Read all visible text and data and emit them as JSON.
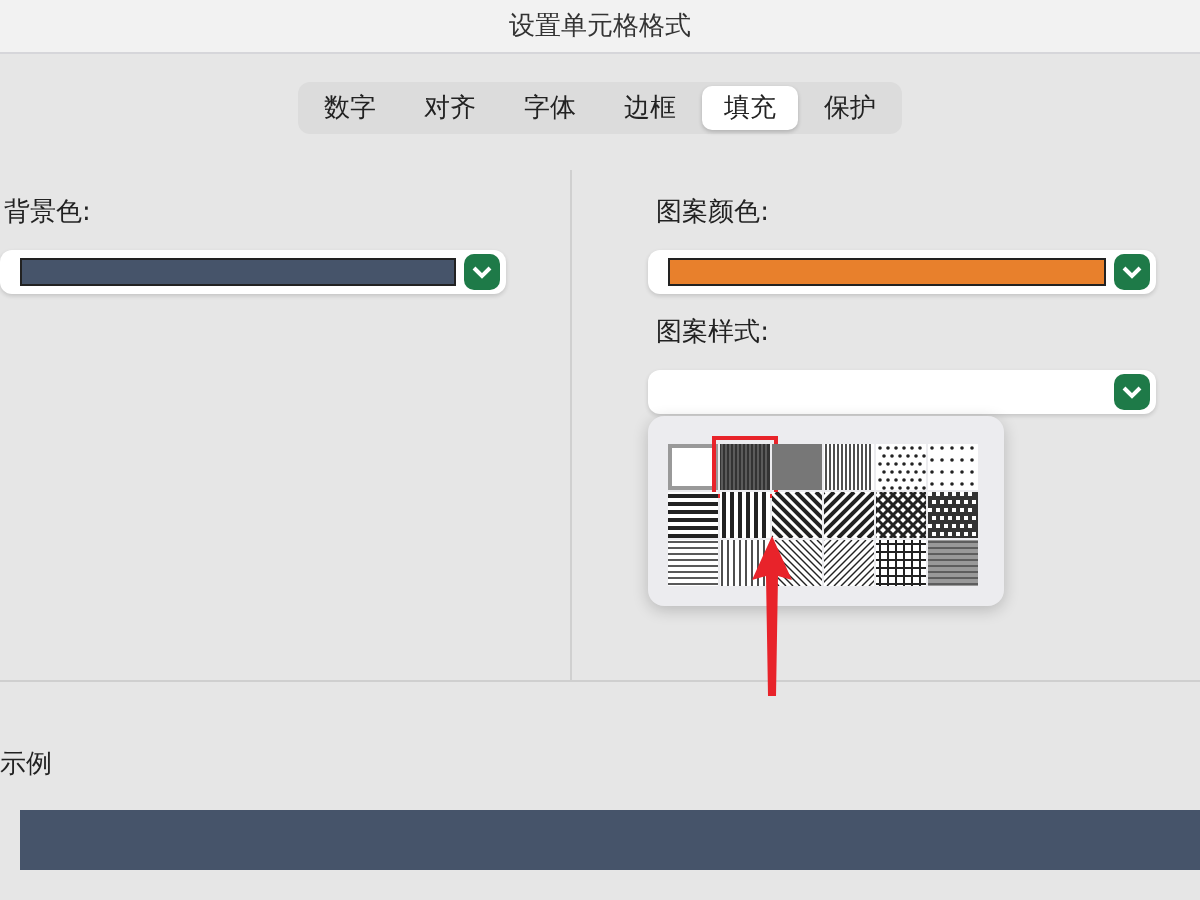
{
  "window": {
    "title": "设置单元格格式"
  },
  "tabs": [
    {
      "label": "数字",
      "selected": false
    },
    {
      "label": "对齐",
      "selected": false
    },
    {
      "label": "字体",
      "selected": false
    },
    {
      "label": "边框",
      "selected": false
    },
    {
      "label": "填充",
      "selected": true
    },
    {
      "label": "保护",
      "selected": false
    }
  ],
  "background": {
    "label": "背景色:",
    "color": "#46546a"
  },
  "pattern_color": {
    "label": "图案颜色:",
    "color": "#e8802c"
  },
  "pattern_style": {
    "label": "图案样式:"
  },
  "patterns": [
    {
      "kind": "solid",
      "selected": true,
      "highlighted": false
    },
    {
      "kind": "dark",
      "selected": false,
      "highlighted": true
    },
    {
      "kind": "medium",
      "selected": false,
      "highlighted": false
    },
    {
      "kind": "light",
      "selected": false,
      "highlighted": false
    },
    {
      "kind": "dots",
      "selected": false,
      "highlighted": false
    },
    {
      "kind": "sparse",
      "selected": false,
      "highlighted": false
    },
    {
      "kind": "hlines",
      "selected": false,
      "highlighted": false
    },
    {
      "kind": "vlines",
      "selected": false,
      "highlighted": false
    },
    {
      "kind": "diagdown",
      "selected": false,
      "highlighted": false
    },
    {
      "kind": "diagup",
      "selected": false,
      "highlighted": false
    },
    {
      "kind": "crosshatch",
      "selected": false,
      "highlighted": false
    },
    {
      "kind": "checker",
      "selected": false,
      "highlighted": false
    },
    {
      "kind": "thinh",
      "selected": false,
      "highlighted": false
    },
    {
      "kind": "thinv",
      "selected": false,
      "highlighted": false
    },
    {
      "kind": "thindown",
      "selected": false,
      "highlighted": false
    },
    {
      "kind": "thinup",
      "selected": false,
      "highlighted": false
    },
    {
      "kind": "grid",
      "selected": false,
      "highlighted": false
    },
    {
      "kind": "thincheck",
      "selected": false,
      "highlighted": false
    }
  ],
  "sample": {
    "label": "示例"
  }
}
